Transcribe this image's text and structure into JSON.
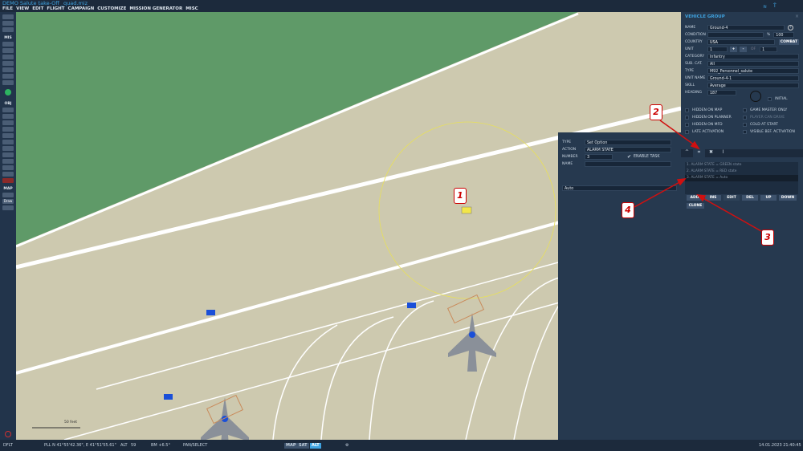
{
  "title": "DEMO Salute take-Off _quad.miz",
  "menu": [
    "FILE",
    "VIEW",
    "EDIT",
    "FLIGHT",
    "CAMPAIGN",
    "CUSTOMIZE",
    "MISSION GENERATOR",
    "MISC"
  ],
  "toolbar": {
    "sections": [
      "MIS",
      "OBJ",
      "MAP"
    ],
    "map_buttons": [
      "Draw"
    ]
  },
  "map": {
    "scale_label": "50 feet",
    "unit_label": "Ground-4"
  },
  "status": {
    "layer": "DFLT",
    "coords": "PLL  N 41°55'42.36\", E 41°51'55.61\"",
    "alt_label": "ALT",
    "alt_value": "59",
    "bm": "BM  +6.5°",
    "mode": "PAN/SELECT",
    "map_btn": "MAP",
    "sat_btn": "SAT",
    "alt_btn": "ALT",
    "datetime": "14.01.2023 21:40:45"
  },
  "vehicle_group": {
    "title": "VEHICLE GROUP",
    "name_label": "NAME",
    "name": "Ground-4",
    "condition_label": "CONDITION",
    "condition_unit": "%",
    "condition": "100",
    "country_label": "COUNTRY",
    "country": "USA",
    "combat": "COMBAT",
    "unit_label": "UNIT",
    "unit": "1",
    "plus": "+",
    "minus": "-",
    "of_label": "OF",
    "of": "1",
    "category_label": "CATEGORY",
    "category": "Infantry",
    "subcat_label": "SUB. CAT.",
    "subcat": "All",
    "type_label": "TYPE",
    "type": "M92_Personnel_salute",
    "unitname_label": "UNIT NAME",
    "unitname": "Ground-4-1",
    "skill_label": "SKILL",
    "skill": "Average",
    "heading_label": "HEADING",
    "heading": "187",
    "initial": "INITIAL",
    "checks": [
      "HIDDEN ON MAP",
      "GAME MASTER ONLY",
      "HIDDEN ON PLANNER",
      "PLAYER CAN DRIVE",
      "HIDDEN ON MFD",
      "COLD AT START",
      "LATE ACTIVATION",
      "VISIBLE BEF. ACTIVATION"
    ],
    "tasks": [
      "1. ALARM STATE = GREEN state",
      "2. ALARM STATE = RED state",
      "3. ALARM STATE = Auto"
    ],
    "buttons": [
      "ADD",
      "INS",
      "EDIT",
      "DEL",
      "UP",
      "DOWN",
      "CLONE"
    ]
  },
  "task_panel": {
    "type_label": "TYPE",
    "type": "Set Option",
    "action_label": "ACTION",
    "action": "ALARM STATE",
    "number_label": "NUMBER",
    "number": "3",
    "enable_task": "ENABLE TASK",
    "name_label": "NAME",
    "value": "Auto"
  },
  "annotations": [
    "1",
    "2",
    "3",
    "4"
  ],
  "colors": {
    "grass": "#5f9a68",
    "tarmac": "#cdc9af",
    "panel": "#26394f",
    "accent": "#3fa3e0"
  }
}
